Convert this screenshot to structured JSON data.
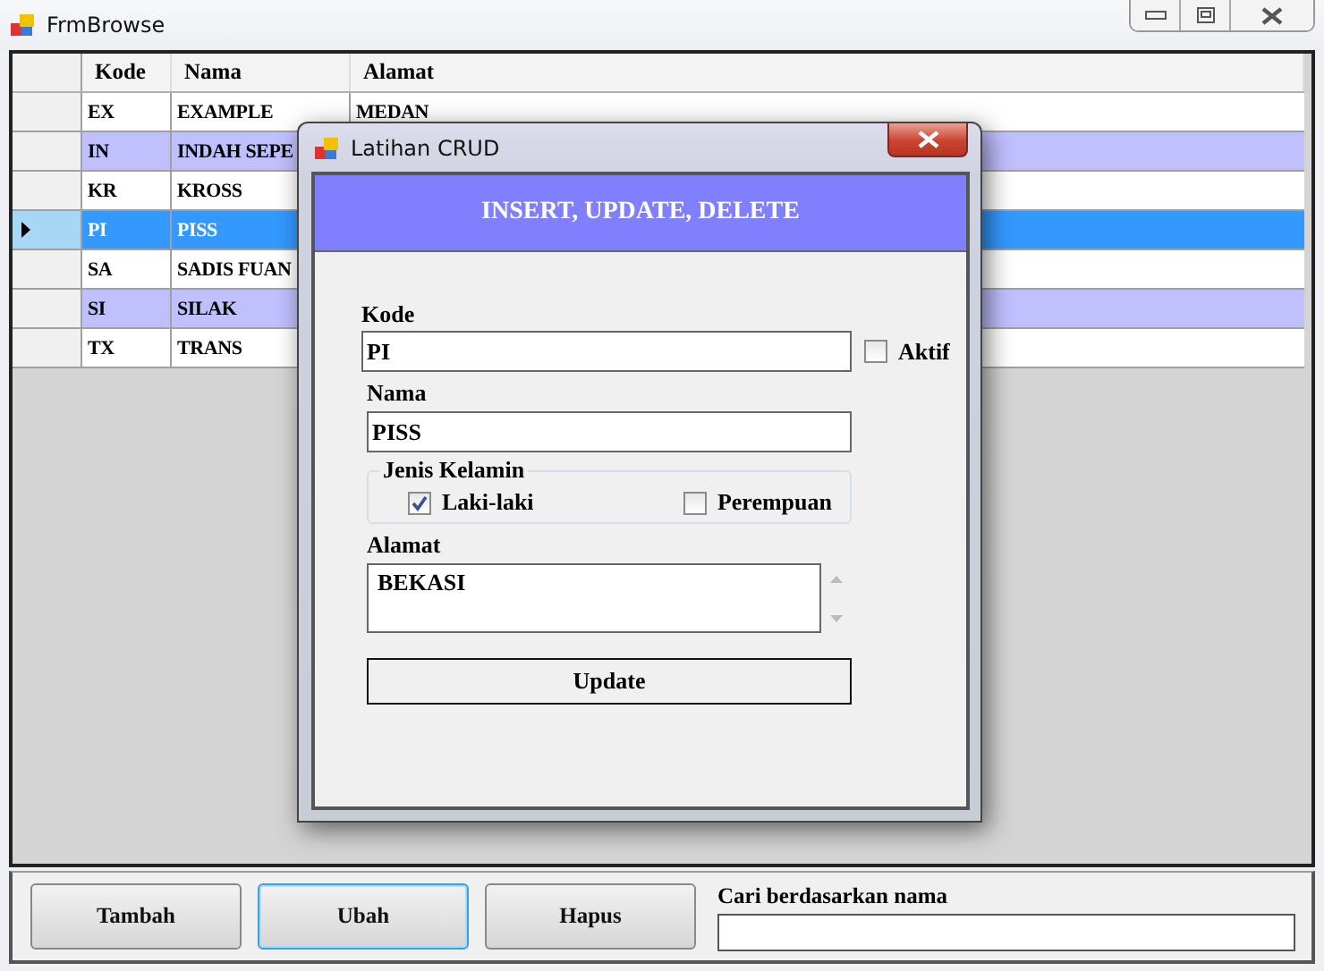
{
  "window": {
    "title": "FrmBrowse"
  },
  "table": {
    "columns": [
      "Kode",
      "Nama",
      "Alamat"
    ],
    "rows": [
      {
        "kode": "EX",
        "nama": "EXAMPLE",
        "alamat": "MEDAN",
        "selected": false
      },
      {
        "kode": "IN",
        "nama": "INDAH SEPE",
        "selected": false
      },
      {
        "kode": "KR",
        "nama": "KROSS",
        "selected": false
      },
      {
        "kode": "PI",
        "nama": "PISS",
        "selected": true
      },
      {
        "kode": "SA",
        "nama": "SADIS FUAN",
        "selected": false
      },
      {
        "kode": "SI",
        "nama": "SILAK",
        "selected": false
      },
      {
        "kode": "TX",
        "nama": "TRANS",
        "selected": false
      }
    ]
  },
  "buttons": [
    {
      "label": "Tambah",
      "focused": false
    },
    {
      "label": "Ubah",
      "focused": true
    },
    {
      "label": "Hapus",
      "focused": false
    }
  ],
  "search": {
    "label": "Cari berdasarkan nama"
  },
  "dialog": {
    "title": "Latihan CRUD",
    "header": "INSERT, UPDATE, DELETE",
    "kode": {
      "label": "Kode",
      "value": "PI"
    },
    "aktif": {
      "label": "Aktif",
      "checked": false
    },
    "nama": {
      "label": "Nama",
      "value": "PISS"
    },
    "gender": {
      "label": "Jenis Kelamin",
      "options": [
        {
          "label": "Laki-laki",
          "checked": true
        },
        {
          "label": "Perempuan",
          "checked": false
        }
      ]
    },
    "alamat": {
      "label": "Alamat",
      "value": "BEKASI"
    },
    "submit": "Update"
  }
}
